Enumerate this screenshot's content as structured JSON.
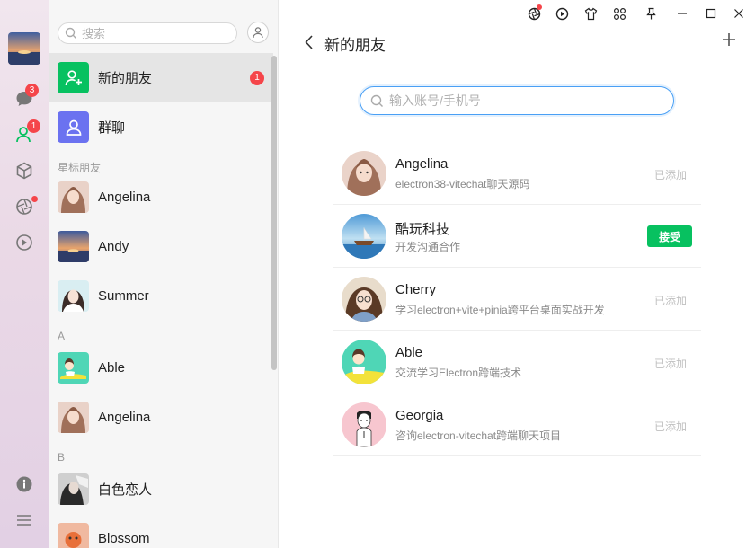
{
  "rail": {
    "chat_badge": "3",
    "contacts_badge": "1"
  },
  "sidebar": {
    "search_placeholder": "搜索",
    "new_friends": {
      "label": "新的朋友",
      "badge": "1"
    },
    "group_chat": {
      "label": "群聊"
    },
    "sections": [
      {
        "title": "星标朋友",
        "items": [
          "Angelina",
          "Andy",
          "Summer"
        ]
      },
      {
        "title": "A",
        "items": [
          "Able",
          "Angelina"
        ]
      },
      {
        "title": "B",
        "items": [
          "白色恋人",
          "Blossom"
        ]
      }
    ]
  },
  "main": {
    "title": "新的朋友",
    "search_placeholder": "输入账号/手机号",
    "requests": [
      {
        "name": "Angelina",
        "message": "electron38-vitechat聊天源码",
        "status": "已添加"
      },
      {
        "name": "酷玩科技",
        "message": "开发沟通合作",
        "action": "接受"
      },
      {
        "name": "Cherry",
        "message": "学习electron+vite+pinia跨平台桌面实战开发",
        "status": "已添加"
      },
      {
        "name": "Able",
        "message": "交流学习Electron跨端技术",
        "status": "已添加"
      },
      {
        "name": "Georgia",
        "message": "咨询electron-vitechat跨端聊天项目",
        "status": "已添加"
      }
    ]
  },
  "colors": {
    "accent_green": "#07c160",
    "badge_red": "#f5454a",
    "focus_blue": "#4aa0f5"
  }
}
